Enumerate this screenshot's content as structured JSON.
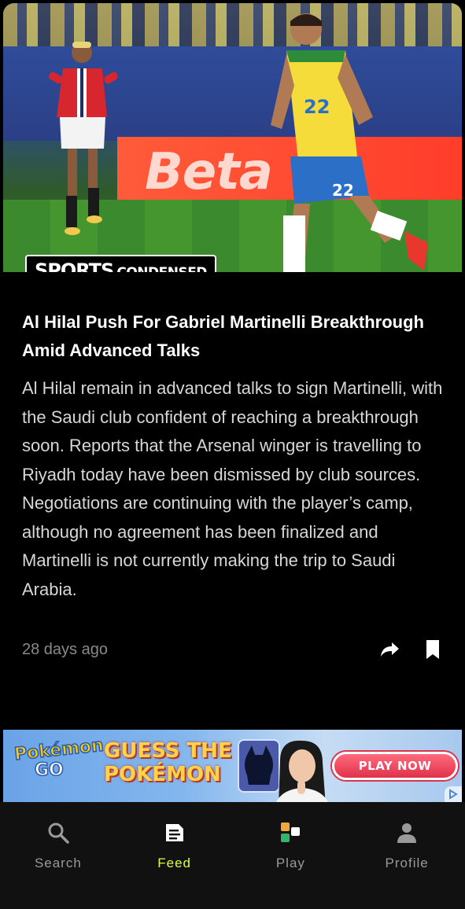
{
  "hero": {
    "brand_primary": "SPORTS",
    "brand_secondary": "CONDENSED",
    "board_text": "Beta",
    "jersey_number": "22",
    "brand_accent_color": "#e8ff3a"
  },
  "article": {
    "title": "Al Hilal Push For Gabriel Martinelli Breakthrough Amid Advanced Talks",
    "body": "Al Hilal remain in advanced talks to sign Martinelli, with the Saudi club confident of reaching a breakthrough soon. Reports that the Arsenal winger is travelling to Riyadh today have been dismissed by club sources. Negotiations are continuing with the player’s camp, although no agreement has been finalized and Martinelli is not currently making the trip to Saudi Arabia.",
    "timestamp": "28 days ago",
    "actions": [
      {
        "icon": "share-icon"
      },
      {
        "icon": "bookmark-icon"
      }
    ]
  },
  "ad": {
    "logo_line1": "Pokémon",
    "logo_line2": "GO",
    "headline_line1": "GUESS THE",
    "headline_line2": "POKÉMON",
    "cta": "PLAY NOW"
  },
  "tabbar": {
    "active_color": "#d9ff3a",
    "tabs": [
      {
        "label": "Search",
        "icon": "search-icon"
      },
      {
        "label": "Feed",
        "icon": "feed-icon"
      },
      {
        "label": "Play",
        "icon": "play-icon"
      },
      {
        "label": "Profile",
        "icon": "profile-icon"
      }
    ]
  }
}
